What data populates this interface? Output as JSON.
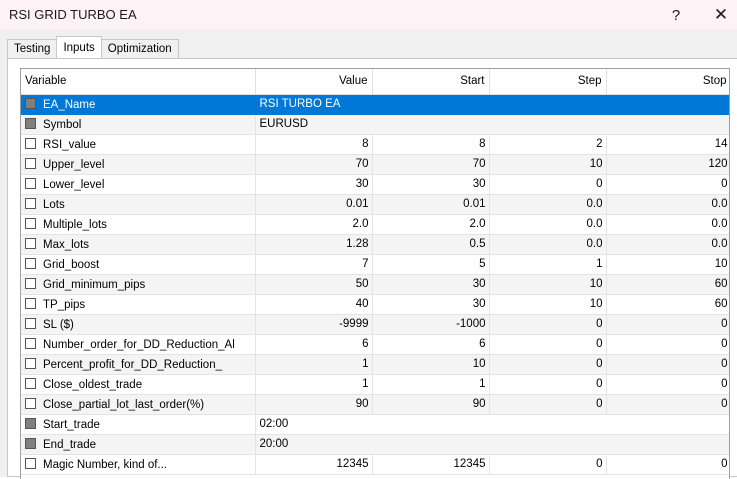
{
  "window": {
    "title": "RSI GRID TURBO EA",
    "help_label": "?",
    "close_label": "✕"
  },
  "tabs": [
    {
      "label": "Testing",
      "active": false
    },
    {
      "label": "Inputs",
      "active": true
    },
    {
      "label": "Optimization",
      "active": false
    }
  ],
  "table": {
    "headers": [
      "Variable",
      "Value",
      "Start",
      "Step",
      "Stop"
    ],
    "rows": [
      {
        "name": "EA_Name",
        "icon": "filled",
        "value": "RSI TURBO EA",
        "start": "",
        "step": "",
        "stop": "",
        "kind": "text",
        "selected": true
      },
      {
        "name": "Symbol",
        "icon": "filled",
        "value": "EURUSD",
        "start": "",
        "step": "",
        "stop": "",
        "kind": "text",
        "selected": false
      },
      {
        "name": "RSI_value",
        "icon": "empty",
        "value": "8",
        "start": "8",
        "step": "2",
        "stop": "14",
        "kind": "num",
        "selected": false
      },
      {
        "name": "Upper_level",
        "icon": "empty",
        "value": "70",
        "start": "70",
        "step": "10",
        "stop": "120",
        "kind": "num",
        "selected": false
      },
      {
        "name": "Lower_level",
        "icon": "empty",
        "value": "30",
        "start": "30",
        "step": "0",
        "stop": "0",
        "kind": "num",
        "selected": false
      },
      {
        "name": "Lots",
        "icon": "empty",
        "value": "0.01",
        "start": "0.01",
        "step": "0.0",
        "stop": "0.0",
        "kind": "num",
        "selected": false
      },
      {
        "name": "Multiple_lots",
        "icon": "empty",
        "value": "2.0",
        "start": "2.0",
        "step": "0.0",
        "stop": "0.0",
        "kind": "num",
        "selected": false
      },
      {
        "name": "Max_lots",
        "icon": "empty",
        "value": "1.28",
        "start": "0.5",
        "step": "0.0",
        "stop": "0.0",
        "kind": "num",
        "selected": false
      },
      {
        "name": "Grid_boost",
        "icon": "empty",
        "value": "7",
        "start": "5",
        "step": "1",
        "stop": "10",
        "kind": "num",
        "selected": false
      },
      {
        "name": "Grid_minimum_pips",
        "icon": "empty",
        "value": "50",
        "start": "30",
        "step": "10",
        "stop": "60",
        "kind": "num",
        "selected": false
      },
      {
        "name": "TP_pips",
        "icon": "empty",
        "value": "40",
        "start": "30",
        "step": "10",
        "stop": "60",
        "kind": "num",
        "selected": false
      },
      {
        "name": "SL ($)",
        "icon": "empty",
        "value": "-9999",
        "start": "-1000",
        "step": "0",
        "stop": "0",
        "kind": "num",
        "selected": false
      },
      {
        "name": "Number_order_for_DD_Reduction_Al",
        "icon": "empty",
        "value": "6",
        "start": "6",
        "step": "0",
        "stop": "0",
        "kind": "num",
        "selected": false
      },
      {
        "name": "Percent_profit_for_DD_Reduction_",
        "icon": "empty",
        "value": "1",
        "start": "10",
        "step": "0",
        "stop": "0",
        "kind": "num",
        "selected": false
      },
      {
        "name": "Close_oldest_trade",
        "icon": "empty",
        "value": "1",
        "start": "1",
        "step": "0",
        "stop": "0",
        "kind": "num",
        "selected": false
      },
      {
        "name": "Close_partial_lot_last_order(%)",
        "icon": "empty",
        "value": "90",
        "start": "90",
        "step": "0",
        "stop": "0",
        "kind": "num",
        "selected": false
      },
      {
        "name": "Start_trade",
        "icon": "filled",
        "value": "02:00",
        "start": "",
        "step": "",
        "stop": "",
        "kind": "text",
        "selected": false
      },
      {
        "name": "End_trade",
        "icon": "filled",
        "value": "20:00",
        "start": "",
        "step": "",
        "stop": "",
        "kind": "text",
        "selected": false
      },
      {
        "name": "Magic Number, kind of...",
        "icon": "empty",
        "value": "12345",
        "start": "12345",
        "step": "0",
        "stop": "0",
        "kind": "num",
        "selected": false
      }
    ]
  }
}
